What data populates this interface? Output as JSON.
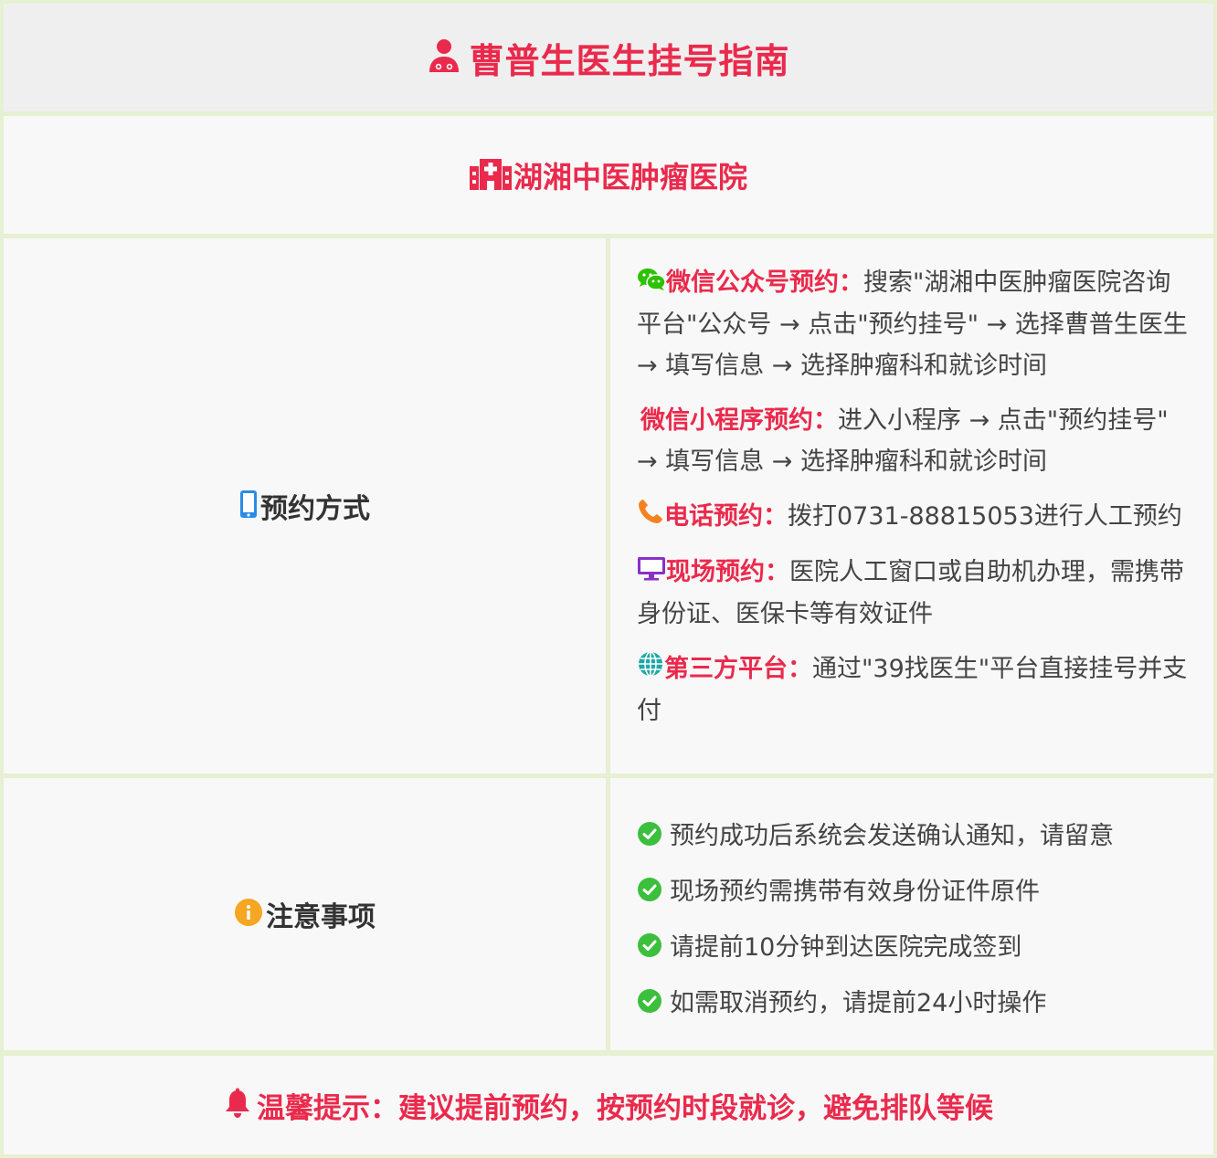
{
  "header": {
    "title": "曹普生医生挂号指南",
    "icon": "doctor-icon"
  },
  "hospital": {
    "name": "湖湘中医肿瘤医院",
    "icon": "hospital-icon"
  },
  "booking": {
    "label": "预约方式",
    "icon": "mobile-phone-icon",
    "methods": [
      {
        "icon": "wechat-icon",
        "label": "微信公众号预约：",
        "text": "搜索\"湖湘中医肿瘤医院咨询平台\"公众号 → 点击\"预约挂号\" → 选择曹普生医生 → 填写信息 → 选择肿瘤科和就诊时间",
        "color": "#ea2a4c"
      },
      {
        "icon": "",
        "label": "微信小程序预约：",
        "text": "进入小程序 → 点击\"预约挂号\" → 填写信息 → 选择肿瘤科和就诊时间",
        "color": "#ea2a4c"
      },
      {
        "icon": "phone-icon",
        "label": "电话预约：",
        "text": "拨打0731-88815053进行人工预约",
        "color": "#ea2a4c"
      },
      {
        "icon": "monitor-icon",
        "label": "现场预约：",
        "text": "医院人工窗口或自助机办理，需携带身份证、医保卡等有效证件",
        "color": "#ea2a4c"
      },
      {
        "icon": "globe-icon",
        "label": "第三方平台：",
        "text": "通过\"39找医生\"平台直接挂号并支付",
        "color": "#ea2a4c"
      }
    ]
  },
  "notes": {
    "label": "注意事项",
    "icon": "info-icon",
    "items": [
      "预约成功后系统会发送确认通知，请留意",
      "现场预约需携带有效身份证件原件",
      "请提前10分钟到达医院完成签到",
      "如需取消预约，请提前24小时操作"
    ]
  },
  "tip": {
    "text": "温馨提示：建议提前预约，按预约时段就诊，避免排队等候",
    "icon": "bell-icon"
  },
  "colors": {
    "accent": "#ea2a4c",
    "border": "#e6f0d2",
    "check": "#3cbf3c",
    "info": "#f5a623"
  }
}
